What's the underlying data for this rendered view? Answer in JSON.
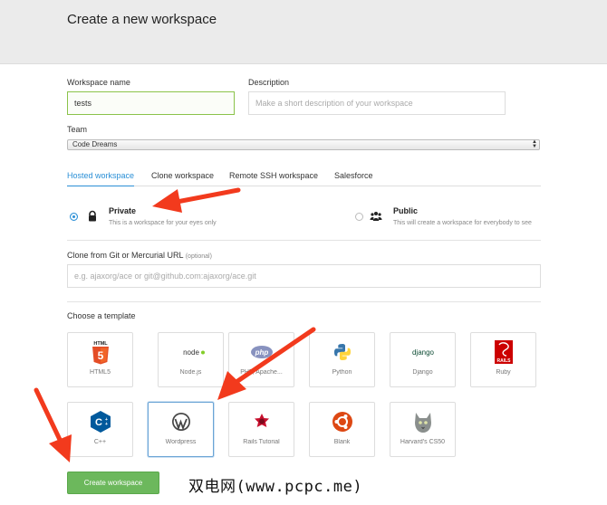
{
  "header": {
    "title": "Create a new workspace"
  },
  "form": {
    "workspace_name_label": "Workspace name",
    "workspace_name_value": "tests",
    "description_label": "Description",
    "description_placeholder": "Make a short description of your workspace",
    "team_label": "Team",
    "team_value": "Code Dreams"
  },
  "tabs": [
    {
      "label": "Hosted workspace",
      "active": true
    },
    {
      "label": "Clone workspace",
      "active": false
    },
    {
      "label": "Remote SSH workspace",
      "active": false
    },
    {
      "label": "Salesforce",
      "active": false
    }
  ],
  "visibility": {
    "private": {
      "title": "Private",
      "desc": "This is a workspace for your eyes only",
      "icon": "lock-icon",
      "checked": true
    },
    "public": {
      "title": "Public",
      "desc": "This will create a workspace for everybody to see",
      "icon": "people-icon",
      "checked": false
    }
  },
  "clone": {
    "label": "Clone from Git or Mercurial URL",
    "optional": "(optional)",
    "placeholder": "e.g. ajaxorg/ace or git@github.com:ajaxorg/ace.git"
  },
  "templates": {
    "label": "Choose a template",
    "items": [
      {
        "name": "HTML5",
        "icon": "html5-icon"
      },
      {
        "name": "Node.js",
        "icon": "nodejs-icon"
      },
      {
        "name": "PHP, Apache...",
        "icon": "php-icon"
      },
      {
        "name": "Python",
        "icon": "python-icon"
      },
      {
        "name": "Django",
        "icon": "django-icon"
      },
      {
        "name": "Ruby",
        "icon": "rails-icon"
      },
      {
        "name": "C++",
        "icon": "cpp-icon"
      },
      {
        "name": "Wordpress",
        "icon": "wordpress-icon",
        "selected": true
      },
      {
        "name": "Rails Tutorial",
        "icon": "rails-tutorial-icon"
      },
      {
        "name": "Blank",
        "icon": "ubuntu-icon"
      },
      {
        "name": "Harvard's CS50",
        "icon": "cs50-icon"
      }
    ]
  },
  "logo_text": {
    "html5": "HTML",
    "html5_number": "5",
    "nodejs": "node",
    "php": "php",
    "django": "django",
    "rails": "RAILS",
    "cpp": "C"
  },
  "submit_label": "Create workspace",
  "watermark": "双电网(www.pcpc.me)",
  "colors": {
    "accent": "#2a8fd6",
    "submit": "#6cb85c",
    "annotation": "#f23a1d"
  }
}
